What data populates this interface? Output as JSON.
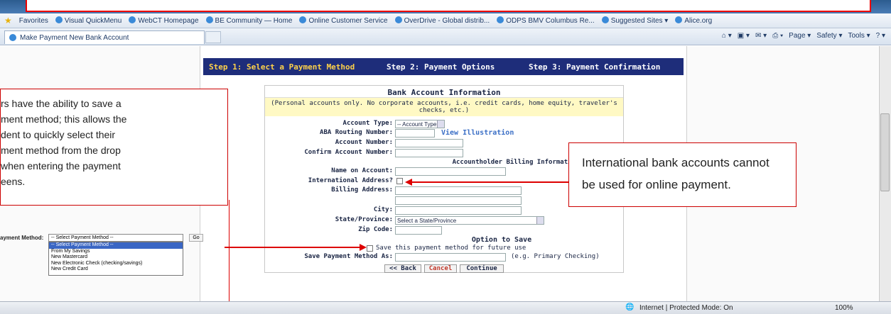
{
  "favorites_bar": {
    "favorites_label": "Favorites",
    "links": [
      "Visual QuickMenu",
      "WebCT Homepage",
      "BE Community — Home",
      "Online Customer Service",
      "OverDrive - Global distrib...",
      "ODPS BMV Columbus Re...",
      "Suggested Sites ▾",
      "Alice.org"
    ]
  },
  "tab": {
    "title": "Make Payment New Bank Account"
  },
  "command_bar": {
    "page": "Page ▾",
    "safety": "Safety ▾",
    "tools": "Tools ▾"
  },
  "steps": {
    "step1": "Step 1: Select a Payment Method",
    "step2": "Step 2: Payment Options",
    "step3": "Step 3: Payment Confirmation"
  },
  "form": {
    "title": "Bank Account Information",
    "note": "(Personal accounts only. No corporate accounts, i.e. credit cards, home equity, traveler's checks, etc.)",
    "account_type_label": "Account Type:",
    "account_type_value": "-- Account Type --",
    "aba_label": "ABA Routing Number:",
    "view_illustration": "View Illustration",
    "account_number_label": "Account Number:",
    "confirm_account_label": "Confirm Account Number:",
    "billing_section": "Accountholder Billing Information",
    "name_label": "Name on Account:",
    "intl_label": "International Address?",
    "billing_label": "Billing Address:",
    "city_label": "City:",
    "state_label": "State/Province:",
    "state_value": "Select a State/Province",
    "zip_label": "Zip Code:",
    "save_section": "Option to Save",
    "save_checkbox_label": "Save this payment method for future use",
    "save_as_label": "Save Payment Method As:",
    "save_as_hint": "(e.g. Primary Checking)",
    "back": "<< Back",
    "cancel": "Cancel",
    "continue": "Continue"
  },
  "note_left": {
    "lines": [
      "rs have the ability to save a",
      "ment method; this allows the",
      "dent to quickly select their",
      "ment method from the drop",
      " when entering the payment",
      "eens."
    ]
  },
  "payment_method_inset": {
    "label": "ayment Method:",
    "selected": "-- Select Payment Method --",
    "go": "Go",
    "options": [
      "-- Select Payment Method --",
      "From My Savings",
      "New Mastercard",
      "New Electronic Check (checking/savings)",
      "New Credit Card"
    ]
  },
  "note_right": {
    "line1": "International bank accounts cannot",
    "line2": "be used for online payment."
  },
  "status": {
    "zone": "Internet | Protected Mode: On",
    "zoom": "100%"
  },
  "colors": {
    "step_bar": "#1e2d7a",
    "step_active": "#ffd24a",
    "callout_border": "#cc0000",
    "note_bg": "#fff9c4"
  }
}
